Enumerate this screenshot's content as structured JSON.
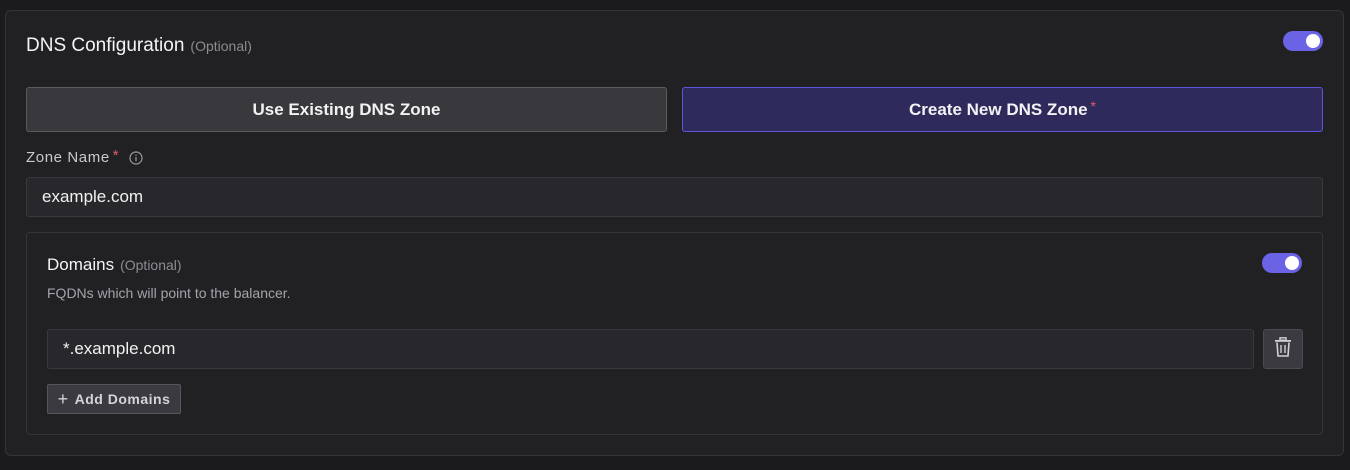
{
  "dns": {
    "title": "DNS Configuration",
    "optional_label": "(Optional)",
    "enabled": true,
    "mode_options": {
      "existing_label": "Use Existing DNS Zone",
      "new_label": "Create New DNS Zone",
      "new_required_mark": "*",
      "selected": "Create New DNS Zone"
    },
    "zone_name": {
      "label": "Zone Name",
      "required_mark": "*",
      "value": "example.com"
    }
  },
  "domains": {
    "title": "Domains",
    "optional_label": "(Optional)",
    "enabled": true,
    "description": "FQDNs which will point to the balancer.",
    "items": [
      "*.example.com"
    ],
    "add_label": "Add Domains"
  },
  "colors": {
    "accent": "#6a63e6",
    "selected_bg": "#2f2a5c",
    "required": "#e05c6b",
    "background": "#1b1b1e",
    "panel": "#212124"
  },
  "icons": {
    "info": "info-icon",
    "trash": "trash-icon",
    "plus": "plus-icon"
  }
}
